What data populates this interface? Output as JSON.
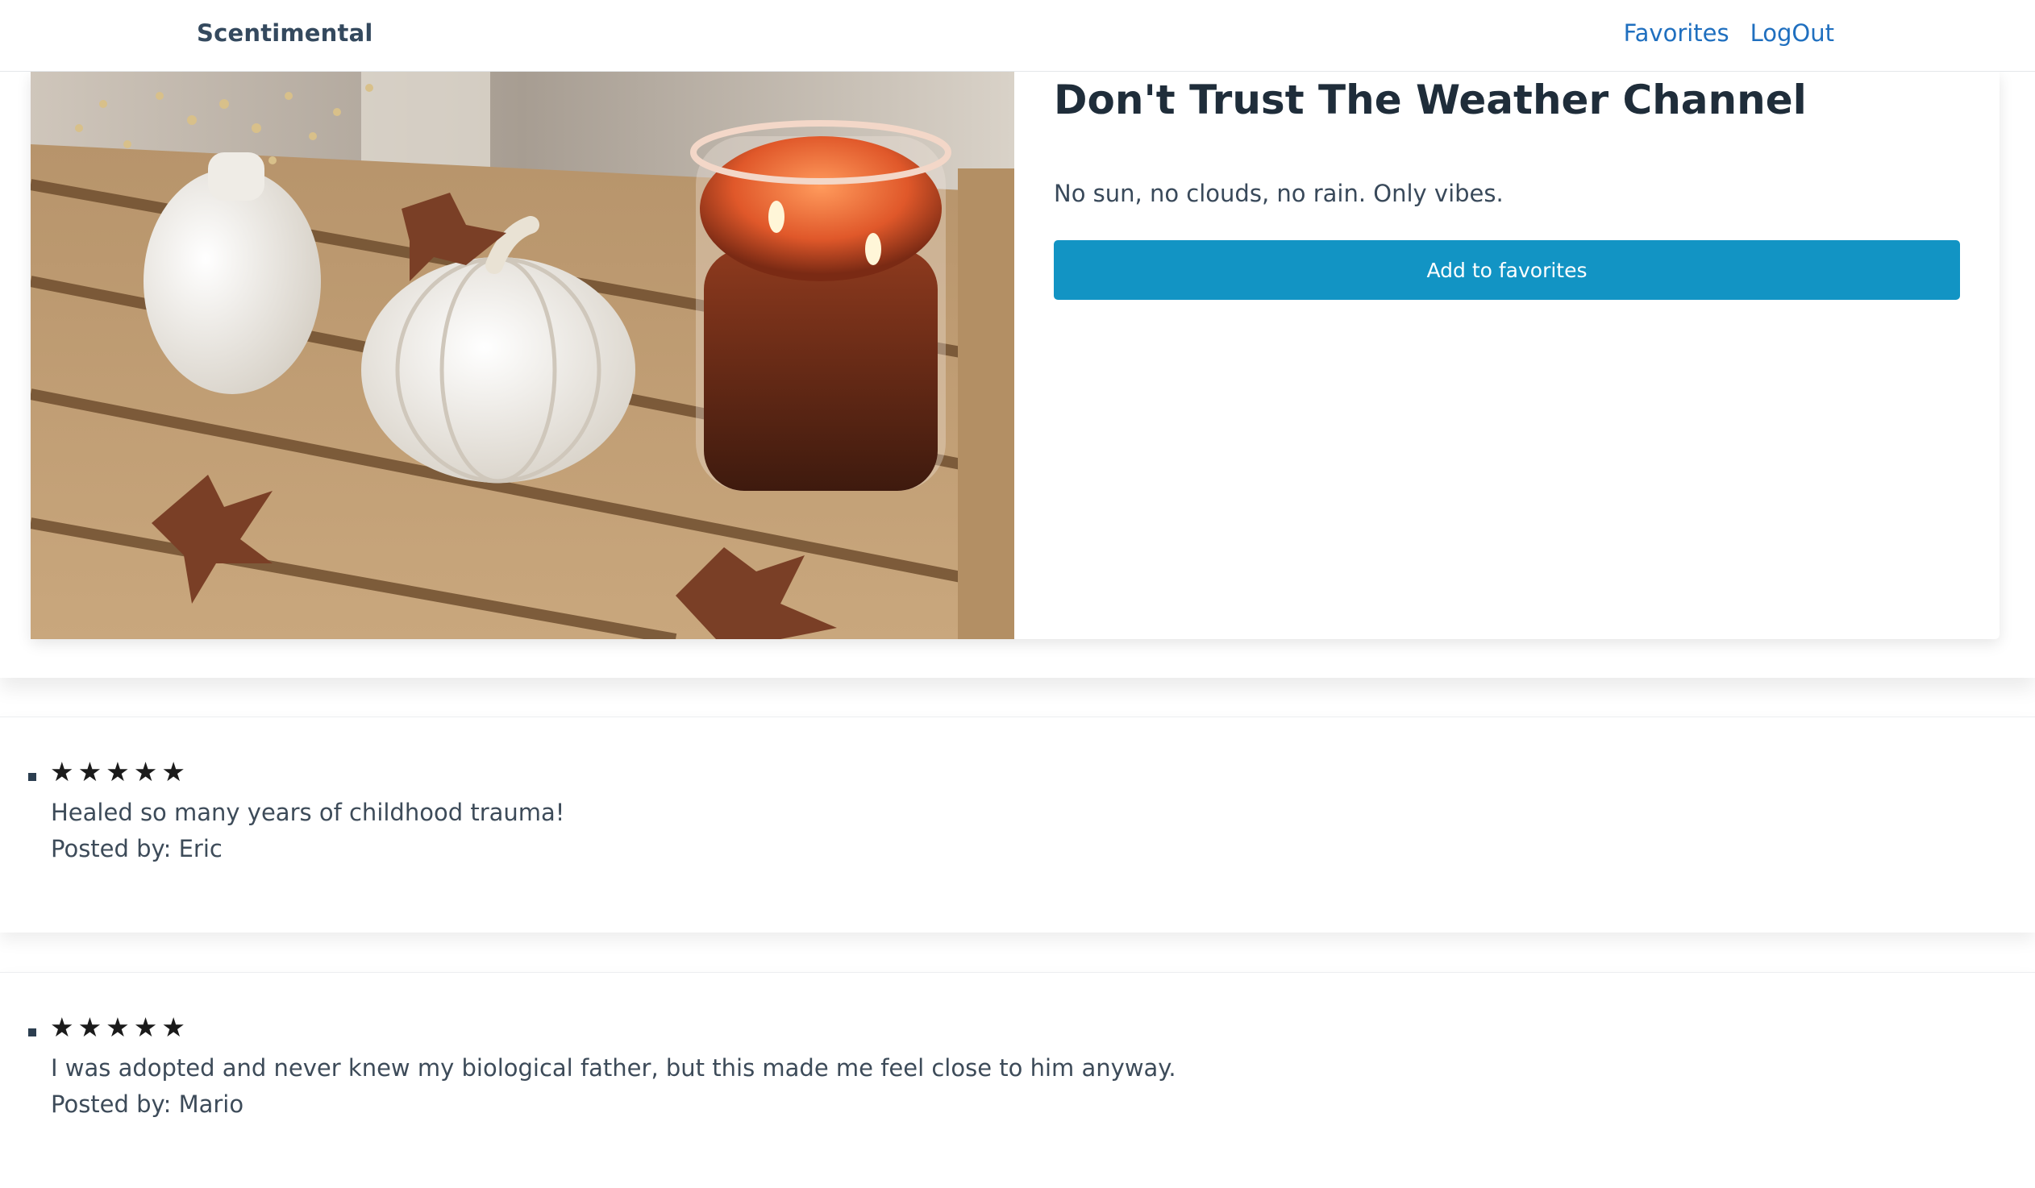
{
  "navbar": {
    "brand": "Scentimental",
    "links": [
      "Favorites",
      "LogOut"
    ]
  },
  "product": {
    "image_description": "candle-with-pumpkin-and-vase",
    "title": "Don't Trust The Weather Channel",
    "description": "No sun, no clouds, no rain. Only vibes.",
    "favorite_button": "Add to favorites"
  },
  "reviews": [
    {
      "stars": "★★★★★",
      "rating": 5,
      "text": "Healed so many years of childhood trauma!",
      "author": "Posted by: Eric"
    },
    {
      "stars": "★★★★★",
      "rating": 5,
      "text": "I was adopted and never knew my biological father, but this made me feel close to him anyway.",
      "author": "Posted by: Mario"
    }
  ],
  "colors": {
    "accent": "#1294c4",
    "link": "#1f6fbf",
    "heading": "#1f2d3a",
    "text": "#3d4b59"
  }
}
